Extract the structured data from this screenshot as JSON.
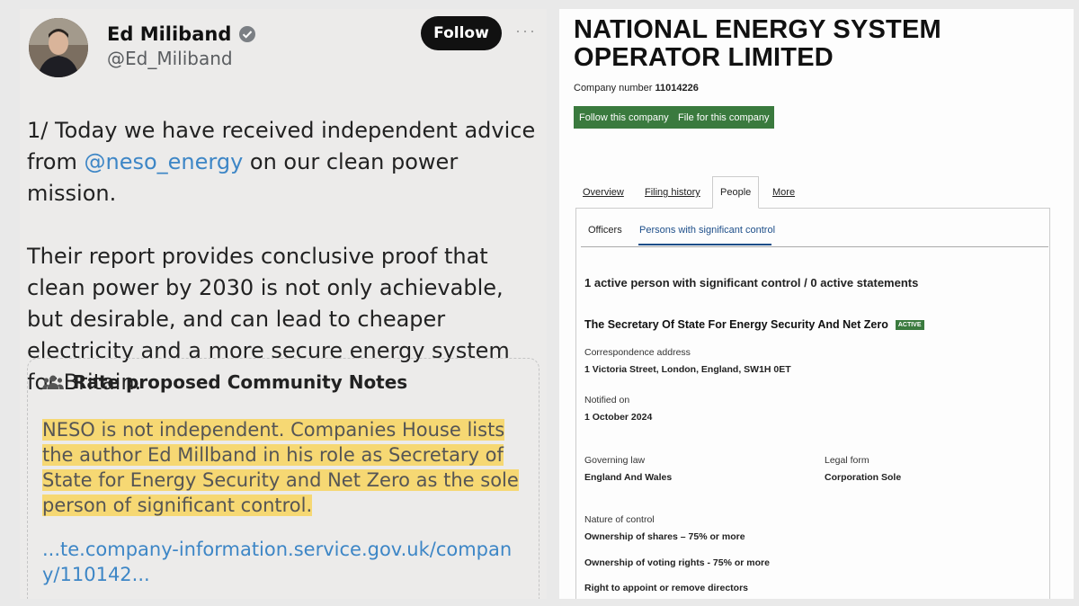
{
  "tweet": {
    "display_name": "Ed Miliband",
    "handle": "@Ed_Miliband",
    "follow_label": "Follow",
    "more_label": "···",
    "para1_before": "1/ Today we have received independent advice from ",
    "para1_mention": "@neso_energy",
    "para1_after": " on our clean power mission.",
    "para2": "Their report provides conclusive proof that clean power by 2030 is not only achievable, but desirable, and can lead to cheaper electricity and a more secure energy system for Britain.",
    "community_notes": {
      "header": "Rate proposed Community Notes",
      "note_highlighted": "NESO is not independent.  Companies House lists the author Ed Millband in his role as Secretary of State for Energy Security and Net Zero as the sole person of significant control.",
      "link": "...te.company-information.service.gov.uk/company/110142..."
    }
  },
  "company": {
    "title": "NATIONAL ENERGY SYSTEM OPERATOR LIMITED",
    "number_label": "Company number",
    "number": "11014226",
    "follow_button": "Follow this company",
    "file_button": "File for this company",
    "tabs": [
      {
        "label": "Overview",
        "active": false
      },
      {
        "label": "Filing history",
        "active": false
      },
      {
        "label": "People",
        "active": true
      },
      {
        "label": "More",
        "active": false
      }
    ],
    "subtabs": [
      {
        "label": "Officers",
        "active": false
      },
      {
        "label": "Persons with significant control",
        "active": true
      }
    ],
    "summary": "1 active person with significant control / 0 active statements",
    "psc": {
      "name": "The Secretary Of State For Energy Security And Net Zero",
      "status_badge": "ACTIVE",
      "correspondence_label": "Correspondence address",
      "correspondence_value": "1 Victoria Street, London, England, SW1H 0ET",
      "notified_label": "Notified on",
      "notified_value": "1 October 2024",
      "governing_law_label": "Governing law",
      "governing_law_value": "England And Wales",
      "legal_form_label": "Legal form",
      "legal_form_value": "Corporation Sole",
      "nature_label": "Nature of control",
      "nature_items": [
        "Ownership of shares – 75% or more",
        "Ownership of voting rights - 75% or more",
        "Right to appoint or remove directors"
      ]
    }
  },
  "colors": {
    "follow_button_bg": "#111111",
    "mention": "#3d86c6",
    "highlight": "#f6d873",
    "company_button": "#3a7a3e",
    "active_badge": "#3a7a3e"
  },
  "icons": {
    "verified": "verified-badge-icon",
    "community_notes": "people-group-icon",
    "more": "more-options-icon"
  }
}
